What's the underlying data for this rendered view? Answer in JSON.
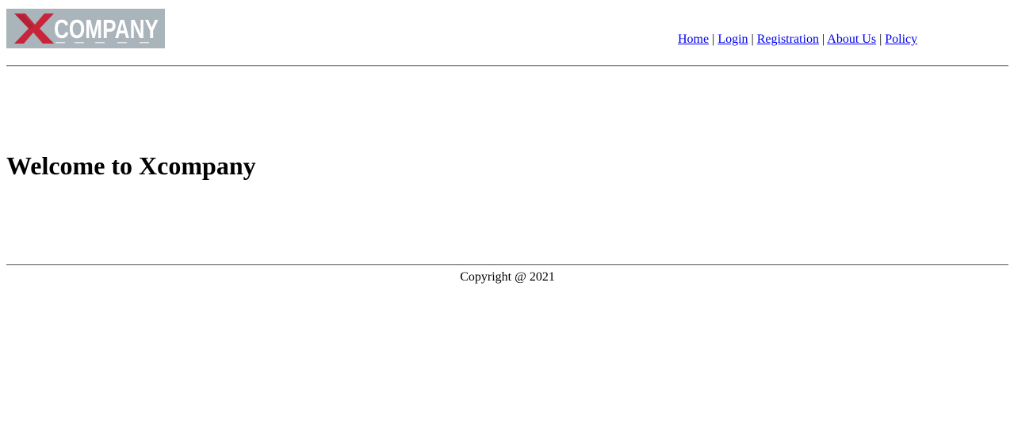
{
  "logo": {
    "text": "XCOMPANY",
    "mark": "X",
    "word": "COMPANY",
    "colors": {
      "background": "#aab4bb",
      "mark": "#c8253a",
      "word": "#ffffff"
    }
  },
  "nav": {
    "items": [
      {
        "label": "Home"
      },
      {
        "label": "Login"
      },
      {
        "label": "Registration"
      },
      {
        "label": "About Us"
      },
      {
        "label": "Policy"
      }
    ],
    "separator": "|"
  },
  "main": {
    "heading": "Welcome to Xcompany"
  },
  "footer": {
    "copyright": "Copyright @ 2021"
  },
  "colors": {
    "link": "#0000ee",
    "rule": "#808080"
  }
}
